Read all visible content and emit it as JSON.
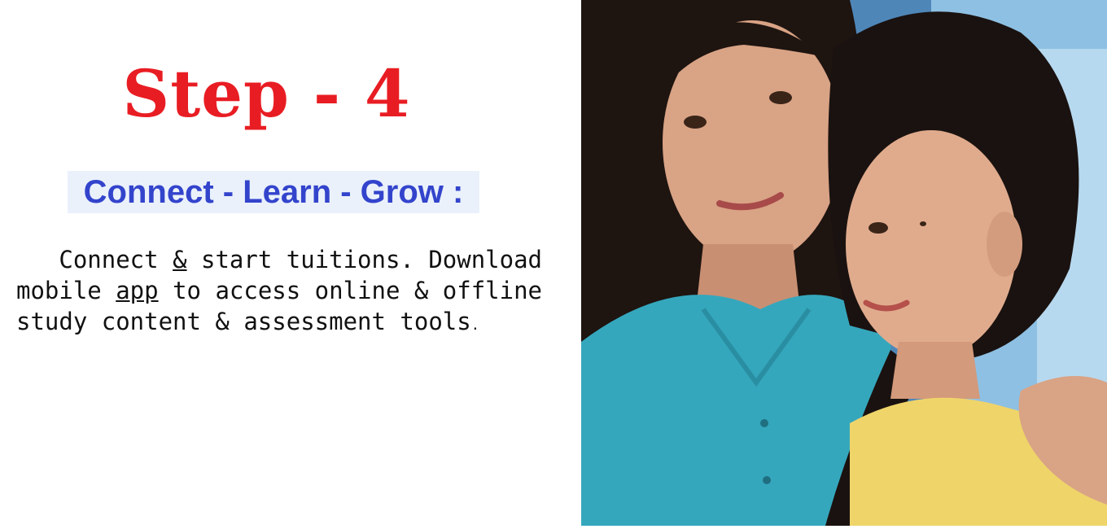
{
  "step": {
    "title": "Step - 4"
  },
  "subtitle": "Connect - Learn - Grow :",
  "description": {
    "line1_a": "   Connect ",
    "line1_amp": "&",
    "line1_b": " start tuitions. Download",
    "line2_a": "mobile ",
    "line2_app": "app",
    "line2_b": " to access online & offline",
    "line3_a": "study content & assessment tools",
    "line3_dot": "."
  },
  "photo": {
    "subject": "teacher-and-student-photo"
  },
  "colors": {
    "title": "#e81d23",
    "subtitle": "#3344cc",
    "subtitle_bg": "#eaf1fb",
    "text": "#111111"
  }
}
